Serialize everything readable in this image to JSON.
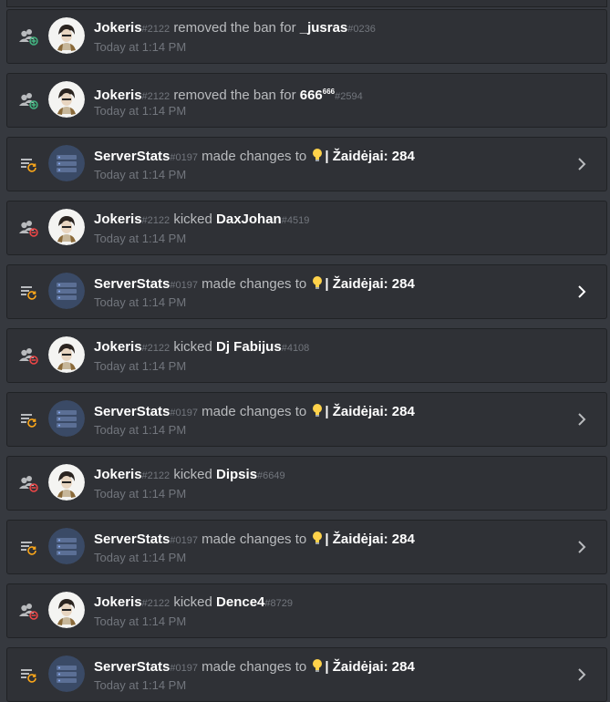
{
  "time_label": "Today at 1:14 PM",
  "colors": {
    "add": "#43b581",
    "remove": "#f04747",
    "update": "#faa61a"
  },
  "entries": [
    {
      "kind": "ban-remove",
      "user": "Jokeris",
      "user_disc": "#2122",
      "action": "removed the ban for",
      "target": "_jusras",
      "target_sup": "",
      "target_disc": "#0236",
      "expandable": false
    },
    {
      "kind": "ban-remove",
      "user": "Jokeris",
      "user_disc": "#2122",
      "action": "removed the ban for",
      "target": "666",
      "target_sup": "666",
      "target_disc": "#2594",
      "expandable": false
    },
    {
      "kind": "update",
      "user": "ServerStats",
      "user_disc": "#0197",
      "action": "made changes to",
      "target": "| Žaidėjai: 284",
      "target_sup": "",
      "target_disc": "",
      "expandable": true
    },
    {
      "kind": "kick",
      "user": "Jokeris",
      "user_disc": "#2122",
      "action": "kicked",
      "target": "DaxJohan",
      "target_sup": "",
      "target_disc": "#4519",
      "expandable": false
    },
    {
      "kind": "update",
      "user": "ServerStats",
      "user_disc": "#0197",
      "action": "made changes to",
      "target": "| Žaidėjai: 284",
      "target_sup": "",
      "target_disc": "",
      "expandable": true,
      "active": true
    },
    {
      "kind": "kick",
      "user": "Jokeris",
      "user_disc": "#2122",
      "action": "kicked",
      "target": "Dj Fabijus",
      "target_sup": "",
      "target_disc": "#4108",
      "expandable": false
    },
    {
      "kind": "update",
      "user": "ServerStats",
      "user_disc": "#0197",
      "action": "made changes to",
      "target": "| Žaidėjai: 284",
      "target_sup": "",
      "target_disc": "",
      "expandable": true
    },
    {
      "kind": "kick",
      "user": "Jokeris",
      "user_disc": "#2122",
      "action": "kicked",
      "target": "Dipsis",
      "target_sup": "",
      "target_disc": "#6649",
      "expandable": false
    },
    {
      "kind": "update",
      "user": "ServerStats",
      "user_disc": "#0197",
      "action": "made changes to",
      "target": "| Žaidėjai: 284",
      "target_sup": "",
      "target_disc": "",
      "expandable": true
    },
    {
      "kind": "kick",
      "user": "Jokeris",
      "user_disc": "#2122",
      "action": "kicked",
      "target": "Dence4",
      "target_sup": "",
      "target_disc": "#8729",
      "expandable": false
    },
    {
      "kind": "update",
      "user": "ServerStats",
      "user_disc": "#0197",
      "action": "made changes to",
      "target": "| Žaidėjai: 284",
      "target_sup": "",
      "target_disc": "",
      "expandable": true
    }
  ]
}
